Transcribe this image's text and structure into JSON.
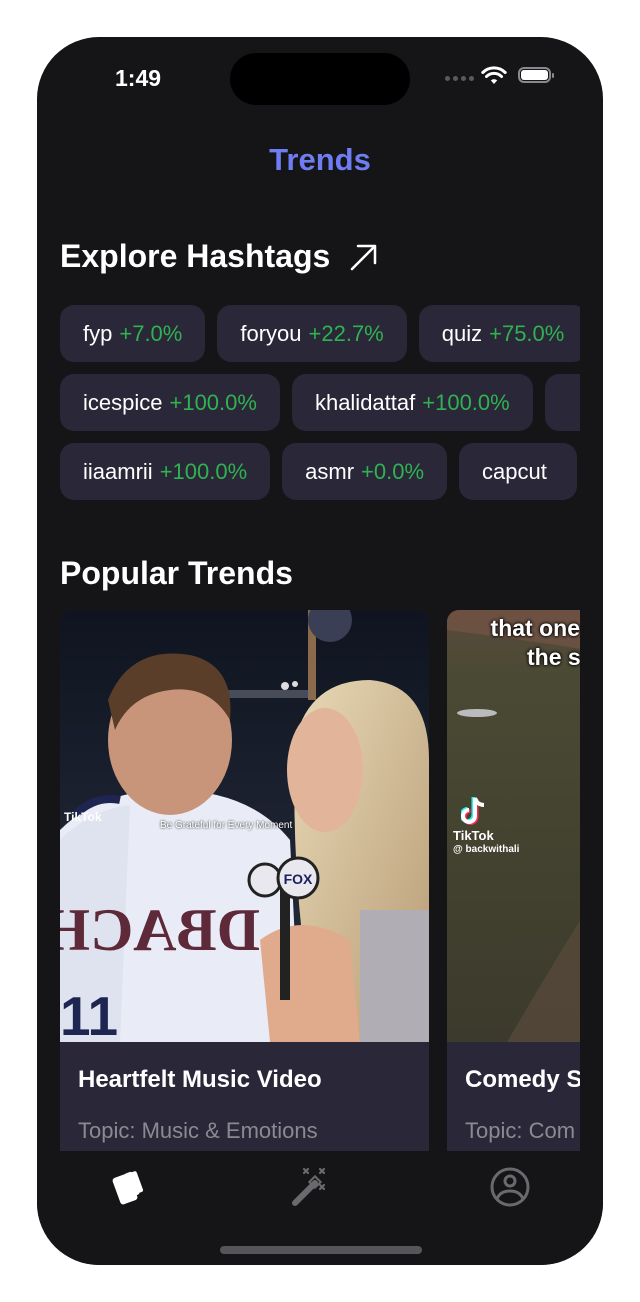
{
  "status_bar": {
    "time": "1:49",
    "wifi_icon": "wifi-icon",
    "battery_icon": "battery-icon"
  },
  "nav": {
    "title": "Trends",
    "title_color": "#6f7df3"
  },
  "explore": {
    "title": "Explore Hashtags",
    "icon": "arrow-up-right-icon",
    "rows": [
      [
        {
          "tag": "fyp",
          "change": "+7.0%"
        },
        {
          "tag": "foryou",
          "change": "+22.7%"
        },
        {
          "tag": "quiz",
          "change": "+75.0%"
        }
      ],
      [
        {
          "tag": "icespice",
          "change": "+100.0%"
        },
        {
          "tag": "khalidattaf",
          "change": "+100.0%"
        },
        {
          "tag": "",
          "change": ""
        }
      ],
      [
        {
          "tag": "iiaamrii",
          "change": "+100.0%"
        },
        {
          "tag": "asmr",
          "change": "+0.0%"
        },
        {
          "tag": "capcut",
          "change": ""
        }
      ]
    ],
    "change_color": "#2fb24f"
  },
  "popular": {
    "title": "Popular Trends",
    "cards": [
      {
        "title": "Heartfelt Music Video",
        "topic": "Topic: Music & Emotions",
        "overlay_caption": "Be Grateful for Every Moment",
        "watermark": "TikTok",
        "jersey_text": "DBACK",
        "mic_logo": "FOX"
      },
      {
        "title": "Comedy S",
        "topic": "Topic: Com",
        "overlay_caption_line1": "that one",
        "overlay_caption_line2": "the s",
        "watermark": "TikTok",
        "watermark_handle": "@ backwithali"
      }
    ]
  },
  "tabbar": {
    "tabs": [
      {
        "name": "cards",
        "icon": "cards-icon",
        "active": true
      },
      {
        "name": "magic",
        "icon": "magic-wand-icon",
        "active": false
      },
      {
        "name": "profile",
        "icon": "profile-icon",
        "active": false
      }
    ]
  }
}
